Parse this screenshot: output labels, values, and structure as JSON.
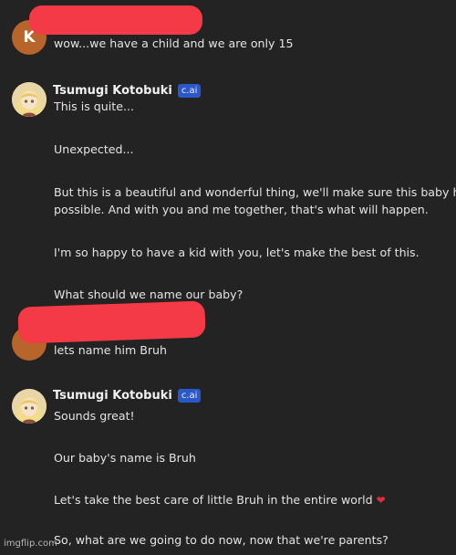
{
  "messages": {
    "user1": {
      "avatar_letter": "K",
      "text": "wow...we have a child and we are only 15"
    },
    "bot1": {
      "name": "Tsumugi Kotobuki",
      "badge": "c.ai",
      "lines": [
        "This is quite...",
        "Unexpected...",
        "But this is a beautiful and wonderful thing, we'll make sure this baby has",
        "possible. And with you and me together, that's what will happen.",
        "I'm so happy to have a kid with you, let's make the best of this.",
        "What should we name our baby?"
      ]
    },
    "user2": {
      "text": "lets name him Bruh"
    },
    "bot2": {
      "name": "Tsumugi Kotobuki",
      "badge": "c.ai",
      "lines": [
        "Sounds great!",
        "Our baby's name is Bruh",
        "Let's take the best care of little Bruh in the entire world",
        "So, what are we going to do now, now that we're parents?"
      ],
      "heart_icon": "❤"
    }
  },
  "watermark": "imgflip.com",
  "colors": {
    "background": "#232323",
    "redaction": "#f33a46",
    "badge": "#2b58c9",
    "user_avatar": "#b8652c"
  }
}
